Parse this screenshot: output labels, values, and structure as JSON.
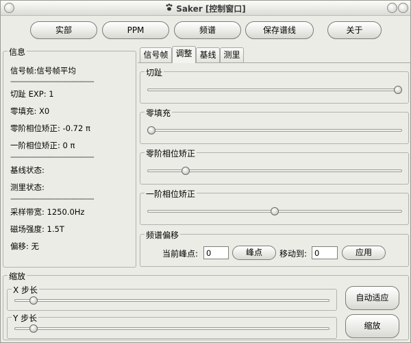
{
  "window": {
    "title": "Saker [控制窗口]"
  },
  "toolbar": {
    "buttons": [
      "实部",
      "PPM",
      "频谱",
      "保存谱线",
      "关于"
    ]
  },
  "info": {
    "title": "信息",
    "frame": "信号帧:信号帧平均",
    "separator": "-----------------------------------------",
    "cut_exp": "切趾 EXP: 1",
    "zero_fill": "零填充: X0",
    "phase0": "零阶相位矫正: -0.72 π",
    "phase1": "一阶相位矫正: 0 π",
    "baseline_status": "基线状态:",
    "measure_status": "测里状态:",
    "bandwidth": "采样带宽: 1250.0Hz",
    "field": "磁场强度: 1.5T",
    "offset": "偏移: 无"
  },
  "tabs": [
    "信号帧",
    "调整",
    "基线",
    "测里"
  ],
  "adjust": {
    "cut": {
      "label": "切趾",
      "value": 1.0
    },
    "zero_fill": {
      "label": "零填充",
      "value": 0.0
    },
    "phase0": {
      "label": "零阶相位矫正",
      "value": 0.14
    },
    "phase1": {
      "label": "一阶相位矫正",
      "value": 0.5
    },
    "shift": {
      "label": "频谱偏移",
      "current_peak_label": "当前峰点:",
      "current_peak_value": "0",
      "peak_button": "峰点",
      "move_to_label": "移动到:",
      "move_to_value": "0",
      "apply_button": "应用"
    }
  },
  "zoom": {
    "title": "缩放",
    "x_step": {
      "label": "X 步长",
      "value": 0.05
    },
    "y_step": {
      "label": "Y 步长",
      "value": 0.05
    },
    "auto_fit_button": "自动适应",
    "zoom_button": "缩放"
  }
}
